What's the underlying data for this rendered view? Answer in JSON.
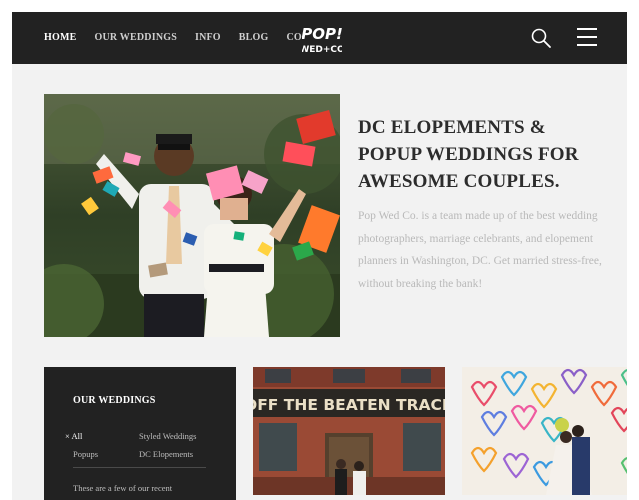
{
  "header": {
    "nav": [
      {
        "label": "HOME",
        "active": true
      },
      {
        "label": "OUR WEDDINGS",
        "active": false
      },
      {
        "label": "INFO",
        "active": false
      },
      {
        "label": "BLOG",
        "active": false
      },
      {
        "label": "CONTACT",
        "active": false
      }
    ],
    "logo": {
      "line1": "POP!",
      "line2": "WED+CO"
    },
    "icons": {
      "search": "search-icon",
      "menu": "hamburger-menu-icon"
    }
  },
  "hero": {
    "title": "DC ELOPEMENTS & POPUP WEDDINGS FOR AWESOME COUPLES.",
    "text": "Pop Wed Co. is a team made up of the best wedding photographers, marriage celebrants, and elopement planners in Washington, DC. Get married stress-free, without breaking the bank!"
  },
  "weddings_panel": {
    "title": "OUR WEDDINGS",
    "filters": {
      "all": "× All",
      "styled": "Styled Weddings",
      "popups": "Popups",
      "dc": "DC Elopements"
    },
    "text": "These are a few of our recent"
  },
  "tiles": {
    "tile1_sign": "OFF THE BEATEN TRACK"
  },
  "colors": {
    "header_bg": "#222222",
    "page_bg": "#f2f2f2",
    "title_text": "#2c2c2c",
    "body_text": "#b9b9b9"
  }
}
